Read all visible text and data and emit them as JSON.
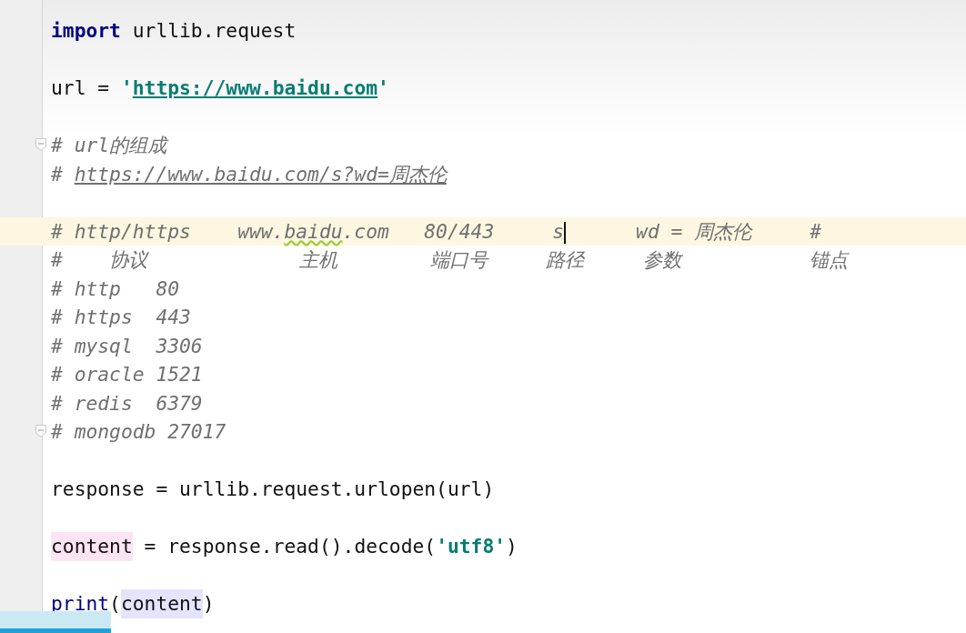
{
  "editor": {
    "lines": [
      {
        "kind": "code",
        "tokens": [
          {
            "kind": "keyword",
            "text": "import"
          },
          {
            "kind": "plain",
            "text": " urllib.request"
          }
        ]
      },
      {
        "kind": "blank"
      },
      {
        "kind": "code",
        "tokens": [
          {
            "kind": "plain",
            "text": "url = "
          },
          {
            "kind": "string",
            "text": "'"
          },
          {
            "kind": "string_url",
            "text": "https://www.baidu.com"
          },
          {
            "kind": "string",
            "text": "'"
          }
        ]
      },
      {
        "kind": "blank"
      },
      {
        "kind": "code",
        "fold": true,
        "tokens": [
          {
            "kind": "comment",
            "text": "# url的组成"
          }
        ]
      },
      {
        "kind": "code",
        "tokens": [
          {
            "kind": "comment",
            "text": "# "
          },
          {
            "kind": "comment_url",
            "text": "https://www.baidu.com/s?wd=周杰伦"
          }
        ]
      },
      {
        "kind": "blank"
      },
      {
        "kind": "code",
        "current": true,
        "tokens": [
          {
            "kind": "comment",
            "text": "# http/https    www."
          },
          {
            "kind": "typo",
            "text": "baidu"
          },
          {
            "kind": "comment",
            "text": ".com   80/443     s"
          },
          {
            "kind": "caret"
          },
          {
            "kind": "comment",
            "text": "      wd = 周杰伦     #"
          }
        ]
      },
      {
        "kind": "code",
        "tokens": [
          {
            "kind": "comment",
            "text": "#    协议             主机        端口号     路径     参数           锚点"
          }
        ]
      },
      {
        "kind": "code",
        "tokens": [
          {
            "kind": "comment",
            "text": "# http   80"
          }
        ]
      },
      {
        "kind": "code",
        "tokens": [
          {
            "kind": "comment",
            "text": "# https  443"
          }
        ]
      },
      {
        "kind": "code",
        "tokens": [
          {
            "kind": "comment",
            "text": "# mysql  3306"
          }
        ]
      },
      {
        "kind": "code",
        "tokens": [
          {
            "kind": "comment",
            "text": "# oracle 1521"
          }
        ]
      },
      {
        "kind": "code",
        "tokens": [
          {
            "kind": "comment",
            "text": "# redis  6379"
          }
        ]
      },
      {
        "kind": "code",
        "fold": true,
        "tokens": [
          {
            "kind": "comment",
            "text": "# mongodb 27017"
          }
        ]
      },
      {
        "kind": "blank"
      },
      {
        "kind": "code",
        "tokens": [
          {
            "kind": "plain",
            "text": "response = urllib.request.urlopen(url)"
          }
        ]
      },
      {
        "kind": "blank"
      },
      {
        "kind": "code",
        "tokens": [
          {
            "kind": "write_usage",
            "text": "content"
          },
          {
            "kind": "plain",
            "text": " = response.read().decode("
          },
          {
            "kind": "string",
            "text": "'utf8'"
          },
          {
            "kind": "plain",
            "text": ")"
          }
        ]
      },
      {
        "kind": "blank"
      },
      {
        "kind": "code",
        "tokens": [
          {
            "kind": "builtin",
            "text": "print"
          },
          {
            "kind": "plain",
            "text": "("
          },
          {
            "kind": "read_usage",
            "text": "content"
          },
          {
            "kind": "plain",
            "text": ")"
          }
        ]
      }
    ]
  },
  "playback": {
    "level": 0.115
  }
}
